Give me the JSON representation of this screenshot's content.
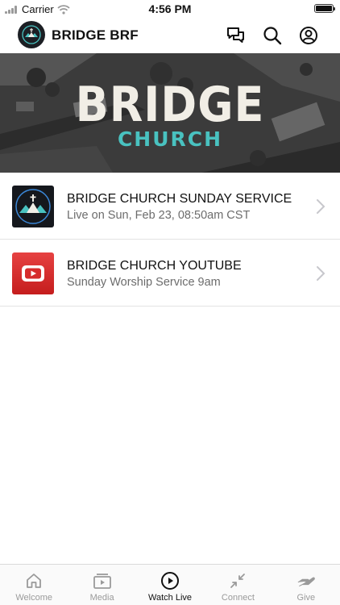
{
  "status_bar": {
    "carrier": "Carrier",
    "time": "4:56 PM"
  },
  "header": {
    "title": "BRIDGE BRF"
  },
  "hero": {
    "title": "BRIDGE",
    "subtitle": "CHURCH"
  },
  "list": [
    {
      "title": "BRIDGE CHURCH SUNDAY SERVICE",
      "subtitle": "Live on Sun, Feb 23, 08:50am CST",
      "icon": "church-logo"
    },
    {
      "title": "BRIDGE CHURCH YOUTUBE",
      "subtitle": "Sunday Worship Service 9am",
      "icon": "youtube-logo"
    }
  ],
  "tabs": [
    {
      "label": "Welcome",
      "icon": "home-icon"
    },
    {
      "label": "Media",
      "icon": "media-icon"
    },
    {
      "label": "Watch Live",
      "icon": "play-icon",
      "active": true
    },
    {
      "label": "Connect",
      "icon": "connect-icon"
    },
    {
      "label": "Give",
      "icon": "give-icon"
    }
  ],
  "colors": {
    "accent": "#49c2c0",
    "youtube_red": "#d62b2b",
    "tab_inactive": "#9a9a9a"
  }
}
